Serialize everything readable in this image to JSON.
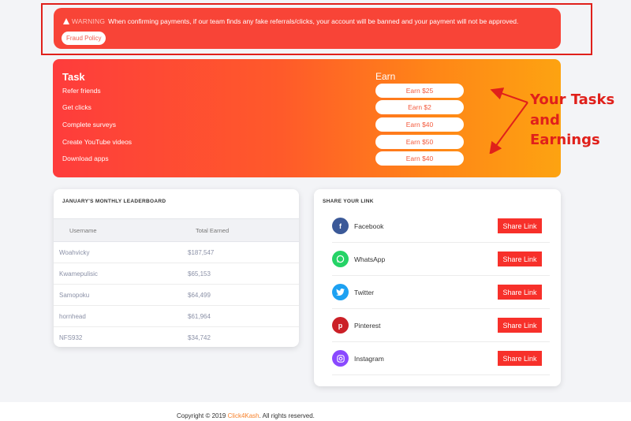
{
  "warning": {
    "tag": "WARNING",
    "message": "When confirming payments, if our team finds any fake referrals/clicks, your account will be banned and your payment will not be approved.",
    "button": "Fraud Policy"
  },
  "tasks": {
    "task_header": "Task",
    "earn_header": "Earn",
    "items": [
      {
        "task": "Refer friends",
        "earn": "Earn $25"
      },
      {
        "task": "Get clicks",
        "earn": "Earn $2"
      },
      {
        "task": "Complete surveys",
        "earn": "Earn $40"
      },
      {
        "task": "Create YouTube videos",
        "earn": "Earn $50"
      },
      {
        "task": "Download apps",
        "earn": "Earn $40"
      }
    ]
  },
  "annotation": {
    "lines": [
      "Your Tasks",
      "and",
      "Earnings"
    ],
    "color": "#e0201b"
  },
  "leaderboard": {
    "title": "JANUARY'S MONTHLY LEADERBOARD",
    "columns": [
      "Username",
      "Total Earned"
    ],
    "rows": [
      {
        "user": "Woahvicky",
        "earned": "$187,547"
      },
      {
        "user": "Kwamepulisic",
        "earned": "$65,153"
      },
      {
        "user": "Samopoku",
        "earned": "$64,499"
      },
      {
        "user": "hornhead",
        "earned": "$61,964"
      },
      {
        "user": "NFS932",
        "earned": "$34,742"
      }
    ]
  },
  "share": {
    "title": "SHARE YOUR LINK",
    "items": [
      {
        "name": "Facebook",
        "icon": "facebook-icon",
        "button": "Share Link",
        "color": "#3b5998"
      },
      {
        "name": "WhatsApp",
        "icon": "whatsapp-icon",
        "button": "Share Link",
        "color": "#25d366"
      },
      {
        "name": "Twitter",
        "icon": "twitter-icon",
        "button": "Share Link",
        "color": "#1da1f2"
      },
      {
        "name": "Pinterest",
        "icon": "pinterest-icon",
        "button": "Share Link",
        "color": "#cb2027"
      },
      {
        "name": "Instagram",
        "icon": "instagram-icon",
        "button": "Share Link",
        "color": "#8a49ff"
      }
    ]
  },
  "footer": {
    "prefix": "Copyright © 2019 ",
    "brand": "Click4Kash",
    "suffix": ". All rights reserved."
  }
}
